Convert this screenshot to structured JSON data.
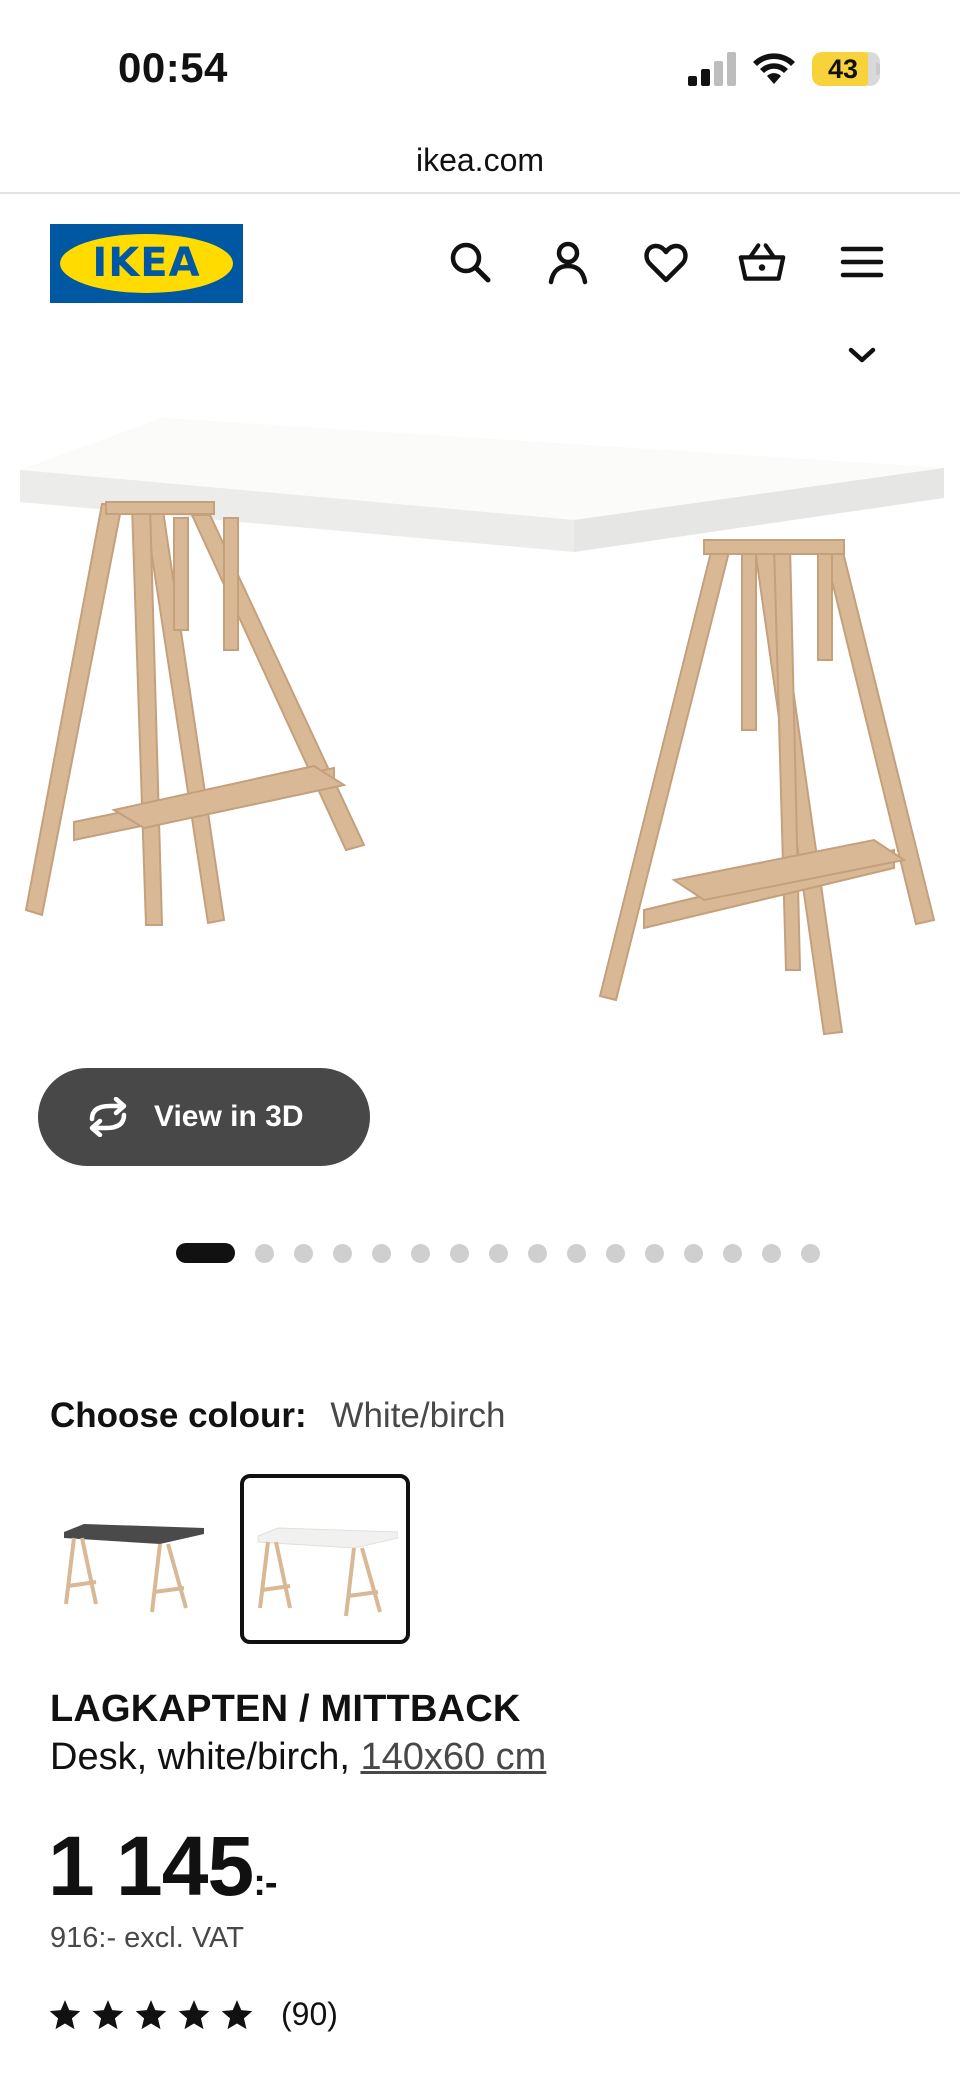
{
  "status_bar": {
    "time": "00:54",
    "battery": "43"
  },
  "browser": {
    "url": "ikea.com"
  },
  "header": {
    "logo_text": "IKEA",
    "icons": [
      "search-icon",
      "account-icon",
      "heart-icon",
      "basket-icon",
      "menu-icon"
    ]
  },
  "gallery": {
    "view_3d_label": "View in 3D",
    "total_images": 16,
    "current_index": 1
  },
  "colour": {
    "label": "Choose colour:",
    "selected": "White/birch"
  },
  "product": {
    "name": "LAGKAPTEN / MITTBACK",
    "description": "Desk, white/birch, ",
    "size_link": "140x60 cm",
    "price": "1 145",
    "price_suffix": ":-",
    "price_excl_vat": "916:- excl. VAT",
    "rating_stars": 5,
    "review_count": "(90)"
  },
  "colors": {
    "brand_blue": "#0058a3",
    "brand_yellow": "#ffdb00",
    "button_dark": "#484848",
    "wood": "#d9b896"
  }
}
